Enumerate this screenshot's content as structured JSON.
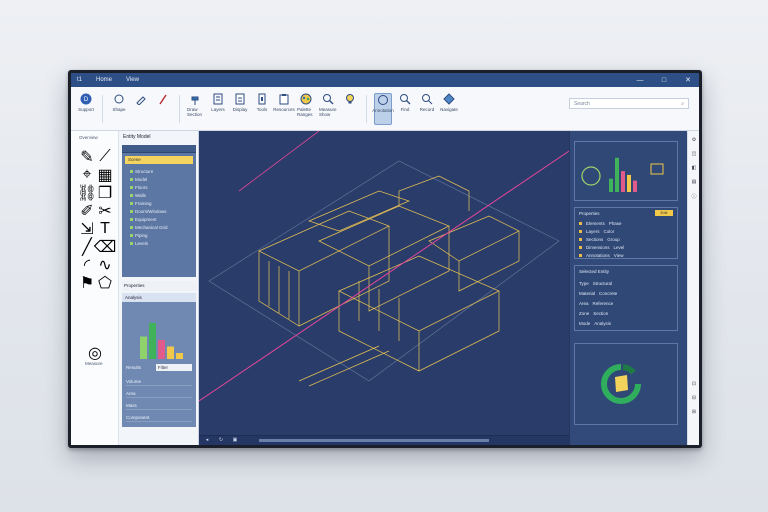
{
  "titlebar": {
    "app_icon": "app-icon",
    "tab_home": "Home",
    "tab_view": "View"
  },
  "ribbon": {
    "search_placeholder": "Search",
    "tools": [
      {
        "label": "Support",
        "icon": "support-icon"
      },
      {
        "label": "Shape",
        "icon": "shape-icon"
      },
      {
        "label": "",
        "icon": "brush-icon"
      },
      {
        "label": "",
        "icon": "pen-icon"
      },
      {
        "label": "Draw Section",
        "icon": "hammer-icon"
      },
      {
        "label": "Layers",
        "icon": "layers-icon"
      },
      {
        "label": "Display",
        "icon": "document-icon"
      },
      {
        "label": "Tools",
        "icon": "tools-icon"
      },
      {
        "label": "Resources",
        "icon": "clipboard-icon"
      },
      {
        "label": "Palette Ranges",
        "icon": "palette-icon"
      },
      {
        "label": "Measure Show",
        "icon": "measure-icon"
      },
      {
        "label": "",
        "icon": "lightbulb-icon"
      },
      {
        "label": "Annotation",
        "icon": "annotation-icon"
      },
      {
        "label": "Find",
        "icon": "find-icon"
      },
      {
        "label": "Record",
        "icon": "record-icon"
      },
      {
        "label": "Navigate",
        "icon": "navigate-icon"
      }
    ]
  },
  "toolstrip": {
    "title": "Overview",
    "bottom_label": "Measure"
  },
  "left_panel": {
    "title": "Entity Model",
    "tree_selected": "Scene",
    "tree_items": [
      "Structure",
      "Model",
      "Floors",
      "Walls",
      "Framing",
      "Doors/Windows",
      "Equipment",
      "Mechanical Grid",
      "Piping",
      "Levels"
    ],
    "props_label": "Properties",
    "chart_header": "Analysis",
    "chart_values": [
      0.45,
      0.72,
      0.38,
      0.25,
      0.12
    ],
    "chart_value_label": "Results",
    "chart_value_field": "Filter",
    "rows": [
      "Volume",
      "Area",
      "Mass",
      "Component"
    ]
  },
  "right_panel": {
    "chart_values": [
      0.35,
      0.9,
      0.55,
      0.45,
      0.3
    ],
    "list_title": "Properties",
    "list_badge": "Edit",
    "list_rows": [
      {
        "name": "Elements",
        "value": "Phase"
      },
      {
        "name": "Layers",
        "value": "Color"
      },
      {
        "name": "Sections",
        "value": "Group"
      },
      {
        "name": "Dimensions",
        "value": "Level"
      },
      {
        "name": "Annotations",
        "value": "View"
      }
    ],
    "props_title": "Selected Entity",
    "props_rows": [
      {
        "name": "Type",
        "value": "Structural"
      },
      {
        "name": "Material",
        "value": "Concrete"
      },
      {
        "name": "Area",
        "value": "Reference"
      },
      {
        "name": "Zone",
        "value": "Section"
      },
      {
        "name": "Mode",
        "value": "Analysis"
      }
    ]
  },
  "colors": {
    "accent": "#2e4f86",
    "wireframe": "#e8c252",
    "section_line": "#e0459a",
    "viewport": "#2a3d6a"
  }
}
